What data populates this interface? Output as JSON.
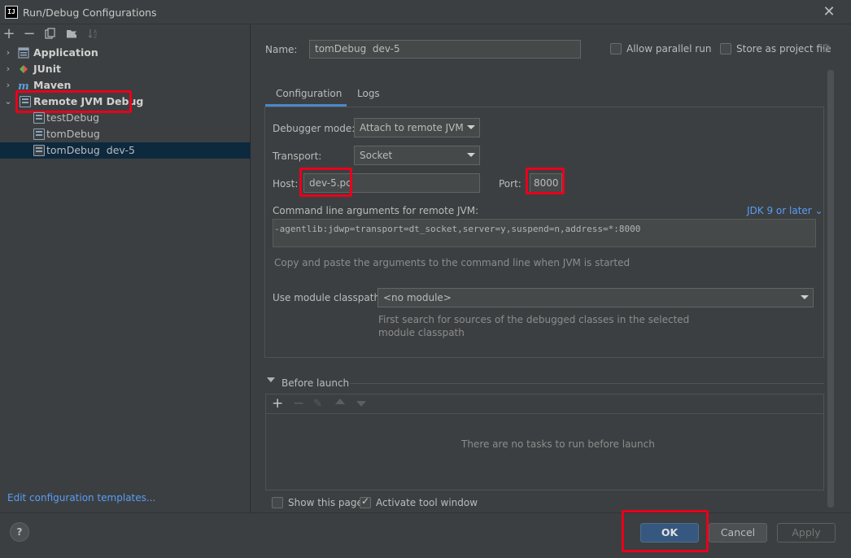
{
  "window": {
    "title": "Run/Debug Configurations",
    "app_icon": "IJ"
  },
  "toolbar": {
    "icons": [
      "add-icon",
      "remove-icon",
      "copy-icon",
      "folder-add-icon",
      "sort-icon"
    ]
  },
  "tree": {
    "items": [
      {
        "label": "Application",
        "icon": "application-icon"
      },
      {
        "label": "JUnit",
        "icon": "junit-icon"
      },
      {
        "label": "Maven",
        "icon": "maven-icon"
      },
      {
        "label": "Remote JVM Debug",
        "icon": "remote-debug-icon"
      },
      {
        "label": "testDebug"
      },
      {
        "label": "tomDebug"
      },
      {
        "label": "tomDebug  dev-5"
      }
    ]
  },
  "left_footer": {
    "edit_templates": "Edit configuration templates..."
  },
  "name_row": {
    "label": "Name:",
    "value": "tomDebug  dev-5",
    "allow_parallel_run": "Allow parallel run",
    "store_as_project_file": "Store as project file"
  },
  "tabs": [
    "Configuration",
    "Logs"
  ],
  "config": {
    "debugger_mode_label": "Debugger mode:",
    "debugger_mode_value": "Attach to remote JVM",
    "transport_label": "Transport:",
    "transport_value": "Socket",
    "host_label": "Host:",
    "host_value": "dev-5.pc",
    "port_label": "Port:",
    "port_value": "8000",
    "cmd_label": "Command line arguments for remote JVM:",
    "jdk_link": "JDK 9 or later",
    "cmd_value": "-agentlib:jdwp=transport=dt_socket,server=y,suspend=n,address=*:8000",
    "cmd_hint": "Copy and paste the arguments to the command line when JVM is started",
    "module_label": "Use module classpath:",
    "module_value": "<no module>",
    "module_hint_1": "First search for sources of the debugged classes in the selected",
    "module_hint_2": "module classpath"
  },
  "before_launch": {
    "title": "Before launch",
    "empty_text": "There are no tasks to run before launch"
  },
  "footer_checks": {
    "show_this_page": "Show this page",
    "activate_tool_window": "Activate tool window"
  },
  "buttons": {
    "ok": "OK",
    "cancel": "Cancel",
    "apply": "Apply",
    "help": "?"
  },
  "colors": {
    "accent": "#365880",
    "link": "#589df6",
    "highlight": "#e8001c",
    "selection": "#0d293e"
  }
}
